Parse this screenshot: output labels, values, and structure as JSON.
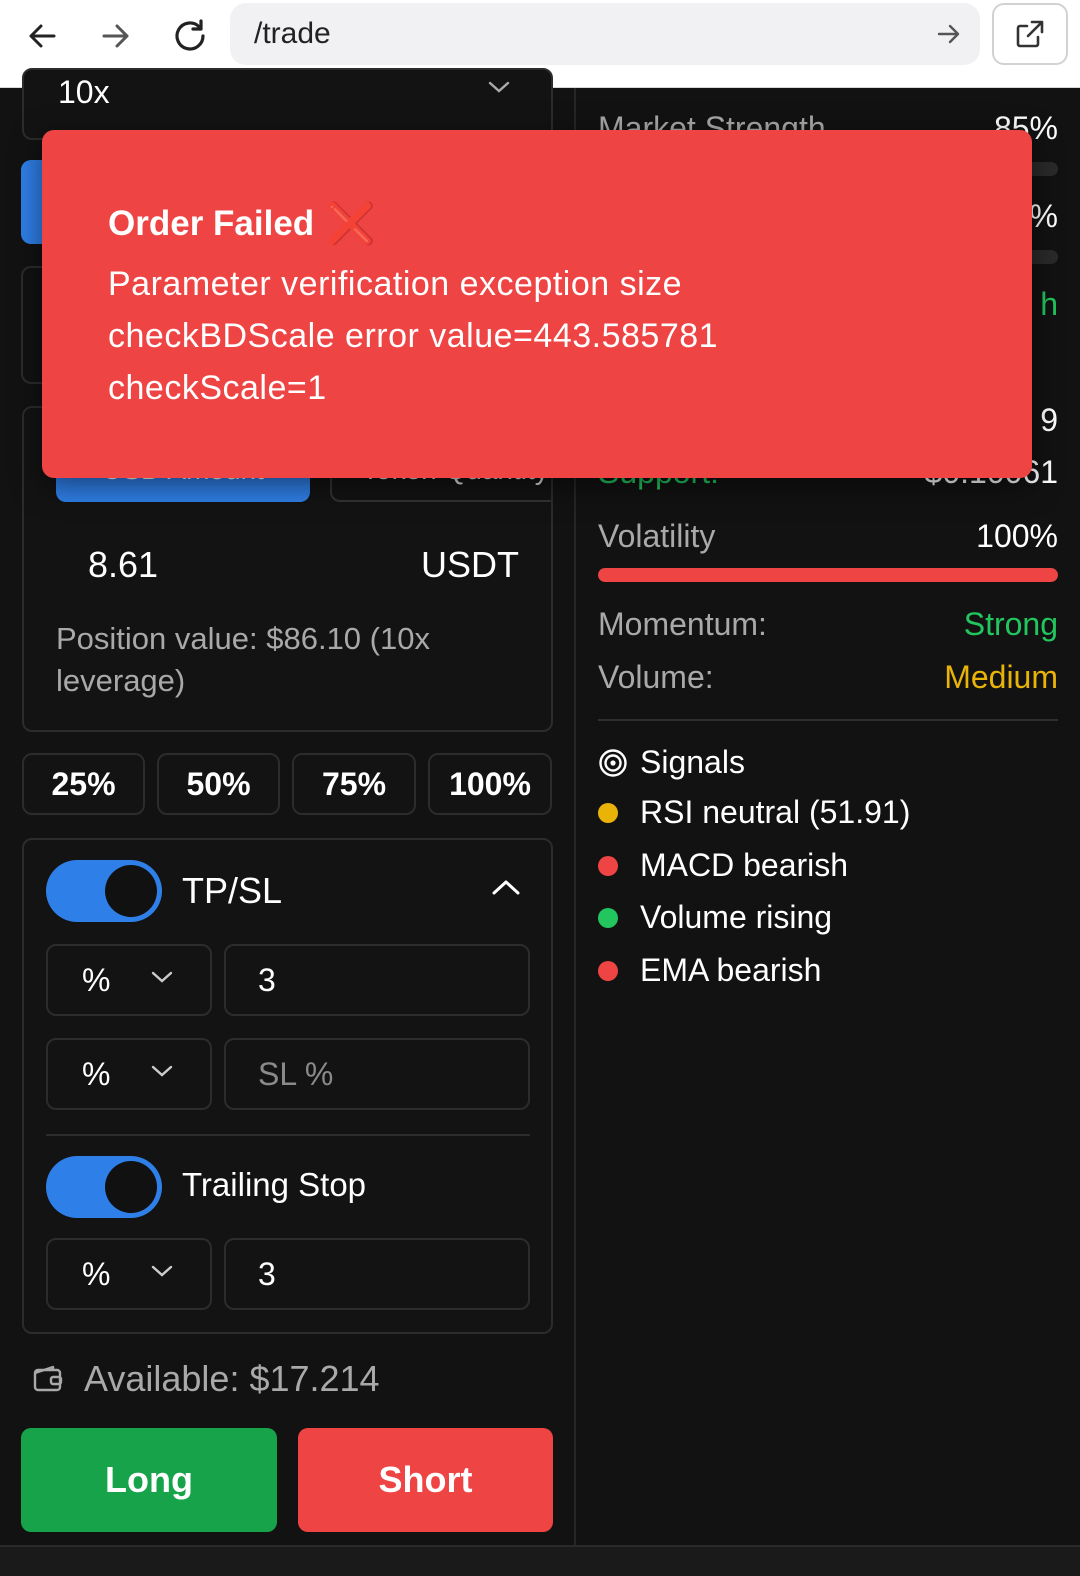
{
  "browser": {
    "url": "/trade"
  },
  "leverage": {
    "value": "10x"
  },
  "amount": {
    "tab_usd": "USD Amount",
    "tab_token": "Token Quantity",
    "value": "8.61",
    "unit": "USDT",
    "position_value": "Position value: $86.10 (10x leverage)"
  },
  "percent_buttons": [
    "25%",
    "50%",
    "75%",
    "100%"
  ],
  "tpsl": {
    "label": "TP/SL",
    "enabled": true,
    "tp_unit": "%",
    "tp_value": "3",
    "sl_unit": "%",
    "sl_placeholder": "SL %",
    "trailing_label": "Trailing Stop",
    "trailing_enabled": true,
    "trailing_unit": "%",
    "trailing_value": "3"
  },
  "wallet": {
    "available": "Available: $17.214"
  },
  "actions": {
    "long": "Long",
    "short": "Short"
  },
  "analysis": {
    "market_strength_label": "Market Strength",
    "market_strength_value": "85%",
    "row2_value_partial": "%",
    "row3_value_partial": "h",
    "row4_value_partial": "9",
    "support_label": "Support:",
    "support_value": "$0.10061",
    "volatility_label": "Volatility",
    "volatility_value": "100%",
    "volatility_fraction": 1.0,
    "momentum_label": "Momentum:",
    "momentum_value": "Strong",
    "volume_label": "Volume:",
    "volume_value": "Medium"
  },
  "signals": {
    "title": "Signals",
    "items": [
      {
        "text": "RSI neutral (51.91)",
        "color": "#eab308"
      },
      {
        "text": "MACD bearish",
        "color": "#ef4444"
      },
      {
        "text": "Volume rising",
        "color": "#22c55e"
      },
      {
        "text": "EMA bearish",
        "color": "#ef4444"
      }
    ]
  },
  "toast": {
    "title": "Order Failed",
    "icon": "cross-mark-icon",
    "message": "Parameter verification exception size checkBDScale error value=443.585781 checkScale=1"
  },
  "colors": {
    "accent": "#2f7fe8",
    "long": "#17a34a",
    "short": "#ef4444",
    "positive": "#22c55e",
    "warning": "#eab308"
  }
}
